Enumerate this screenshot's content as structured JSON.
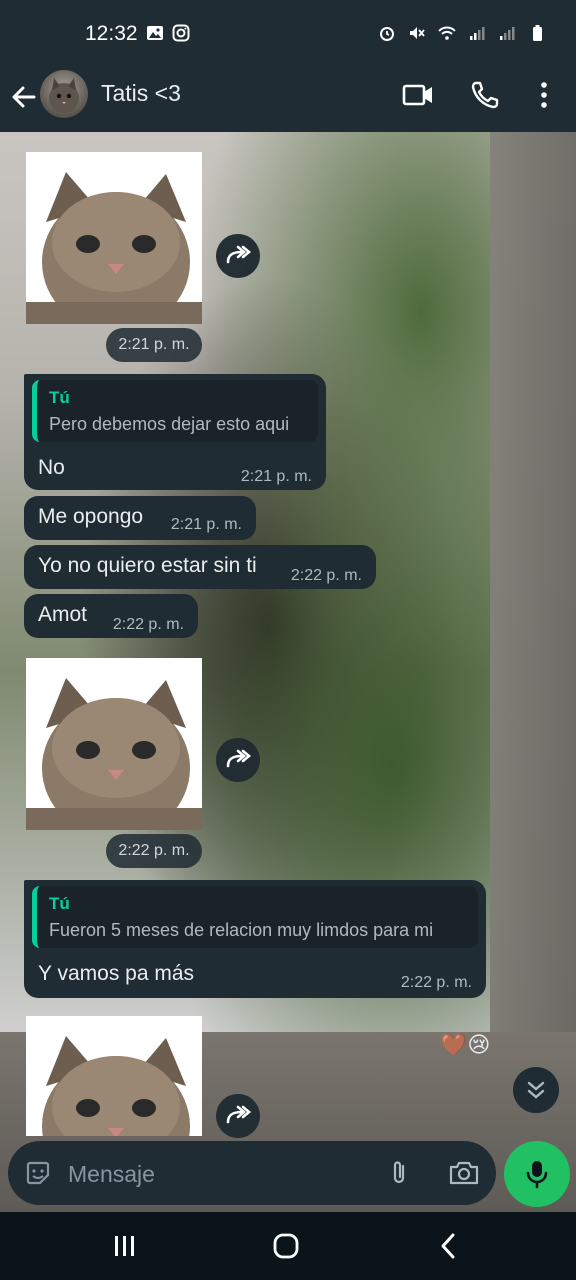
{
  "status_bar": {
    "time": "12:32"
  },
  "header": {
    "contact_name": "Tatis <3"
  },
  "messages": [
    {
      "type": "sticker",
      "time": "2:21 p. m."
    },
    {
      "type": "reply",
      "quote_author": "Tú",
      "quote_text": "Pero debemos dejar esto aqui",
      "text": "No",
      "time": "2:21 p. m."
    },
    {
      "type": "text",
      "text": "Me opongo",
      "time": "2:21 p. m."
    },
    {
      "type": "text",
      "text": "Yo no quiero estar sin ti",
      "time": "2:22 p. m."
    },
    {
      "type": "text",
      "text": "Amot",
      "time": "2:22 p. m."
    },
    {
      "type": "sticker",
      "time": "2:22 p. m."
    },
    {
      "type": "reply",
      "quote_author": "Tú",
      "quote_text": "Fueron 5 meses de relacion muy limdos para mi",
      "text": "Y vamos pa más",
      "time": "2:22 p. m."
    },
    {
      "type": "sticker"
    }
  ],
  "reactions": "🤎😢",
  "input": {
    "placeholder": "Mensaje"
  },
  "colors": {
    "header_bg": "#1f2c34",
    "bubble_bg": "#202c33",
    "accent": "#06cf9c",
    "mic_button": "#21c063"
  },
  "icons": [
    "back-arrow-icon",
    "video-call-icon",
    "phone-icon",
    "more-vert-icon",
    "forward-icon",
    "sticker-icon",
    "attach-icon",
    "camera-icon",
    "mic-icon",
    "double-chevron-down-icon"
  ]
}
